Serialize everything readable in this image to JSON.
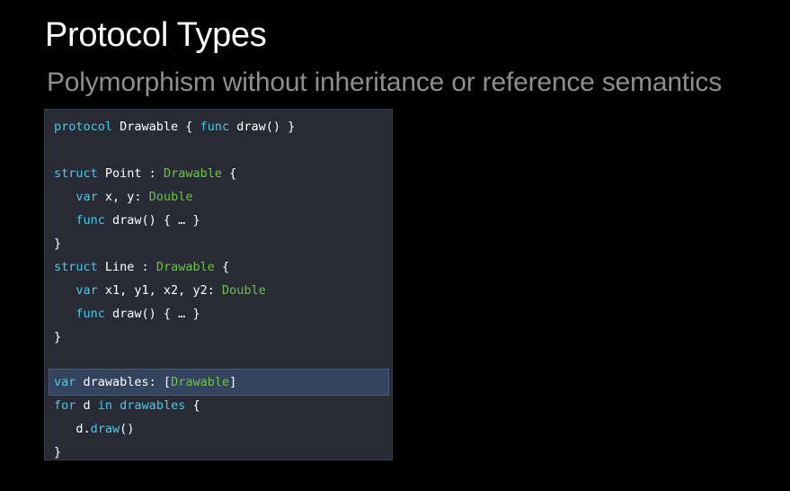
{
  "slide": {
    "title": "Protocol Types",
    "subtitle": "Polymorphism without inheritance or reference semantics"
  },
  "colors": {
    "background": "#000000",
    "code_background": "#282b35",
    "keyword": "#4dc8e6",
    "type": "#6cc644",
    "identifier": "#ffffff",
    "highlight": "#34445e"
  },
  "code": {
    "lines": [
      {
        "tokens": [
          "protocol",
          " Drawable { ",
          "func",
          " draw() }"
        ]
      },
      {
        "tokens": []
      },
      {
        "tokens": [
          "struct",
          " Point : ",
          "Drawable",
          " {"
        ]
      },
      {
        "tokens": [
          "   ",
          "var",
          " x, y: ",
          "Double"
        ]
      },
      {
        "tokens": [
          "   ",
          "func",
          " draw() { … }"
        ]
      },
      {
        "tokens": [
          "}"
        ]
      },
      {
        "tokens": [
          "struct",
          " Line : ",
          "Drawable",
          " {"
        ]
      },
      {
        "tokens": [
          "   ",
          "var",
          " x1, y1, x2, y2: ",
          "Double"
        ]
      },
      {
        "tokens": [
          "   ",
          "func",
          " draw() { … }"
        ]
      },
      {
        "tokens": [
          "}"
        ]
      },
      {
        "tokens": []
      },
      {
        "tokens": [
          "var",
          " drawables: [",
          "Drawable",
          "]"
        ]
      },
      {
        "tokens": [
          "for",
          " d ",
          "in",
          " drawables",
          " {"
        ]
      },
      {
        "tokens": [
          "   d.",
          "draw",
          "()"
        ]
      },
      {
        "tokens": [
          "}"
        ]
      }
    ],
    "highlighted_line": 11
  }
}
